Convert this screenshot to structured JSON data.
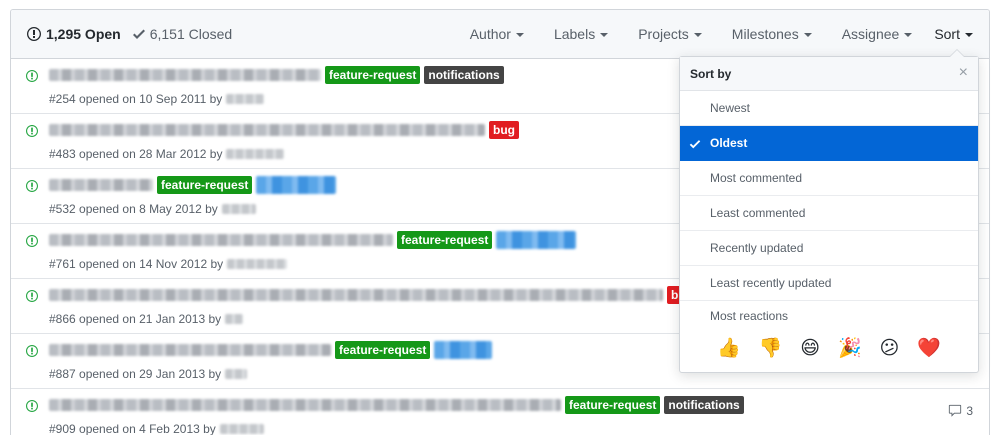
{
  "header": {
    "open_count": "1,295 Open",
    "closed_count": "6,151 Closed",
    "filters": [
      "Author",
      "Labels",
      "Projects",
      "Milestones",
      "Assignee"
    ],
    "sort_label": "Sort"
  },
  "issues": [
    {
      "meta": "#254 opened on 10 Sep 2011 by",
      "labels": [
        {
          "text": "feature-request",
          "color": "#159818"
        },
        {
          "text": "notifications",
          "color": "#444444"
        }
      ]
    },
    {
      "meta": "#483 opened on 28 Mar 2012 by",
      "labels": [
        {
          "text": "bug",
          "color": "#e11d21"
        }
      ]
    },
    {
      "meta": "#532 opened on 8 May 2012 by",
      "labels": [
        {
          "text": "feature-request",
          "color": "#159818"
        }
      ]
    },
    {
      "meta": "#761 opened on 14 Nov 2012 by",
      "labels": [
        {
          "text": "feature-request",
          "color": "#159818"
        }
      ]
    },
    {
      "meta": "#866 opened on 21 Jan 2013 by",
      "labels": [
        {
          "text": "b",
          "color": "#e11d21"
        }
      ]
    },
    {
      "meta": "#887 opened on 29 Jan 2013 by",
      "labels": [
        {
          "text": "feature-request",
          "color": "#159818"
        }
      ]
    },
    {
      "meta": "#909 opened on 4 Feb 2013 by",
      "labels": [
        {
          "text": "feature-request",
          "color": "#159818"
        },
        {
          "text": "notifications",
          "color": "#444444"
        }
      ],
      "comments": "3"
    }
  ],
  "sort_menu": {
    "title": "Sort by",
    "close_glyph": "×",
    "options": [
      "Newest",
      "Oldest",
      "Most commented",
      "Least commented",
      "Recently updated",
      "Least recently updated"
    ],
    "selected": "Oldest",
    "reactions_label": "Most reactions",
    "reactions": [
      {
        "name": "thumbs-up-icon",
        "glyph": "👍"
      },
      {
        "name": "thumbs-down-icon",
        "glyph": "👎"
      },
      {
        "name": "laugh-icon",
        "glyph": "😄"
      },
      {
        "name": "hooray-icon",
        "glyph": "🎉"
      },
      {
        "name": "confused-icon",
        "glyph": "😕"
      },
      {
        "name": "heart-icon",
        "glyph": "❤️"
      }
    ]
  },
  "colors": {
    "open_icon": "#28a745",
    "accent": "#0366d6"
  }
}
